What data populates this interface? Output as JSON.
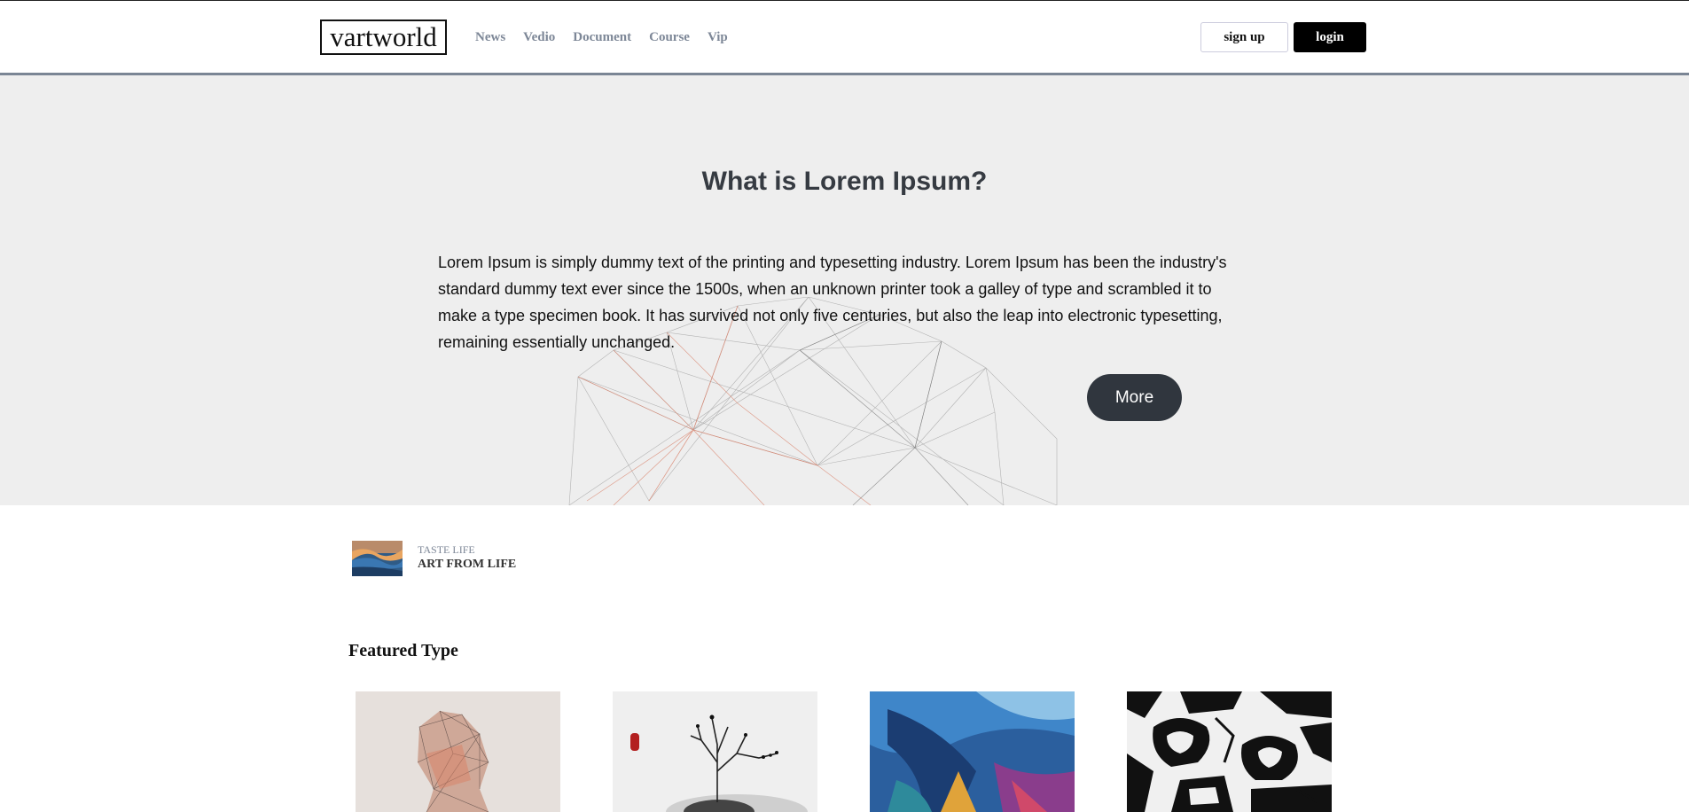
{
  "header": {
    "logo": "vartworld",
    "nav": [
      "News",
      "Vedio",
      "Document",
      "Course",
      "Vip"
    ],
    "signup_label": "sign up",
    "login_label": "login"
  },
  "hero": {
    "title": "What is Lorem Ipsum?",
    "body": "Lorem Ipsum is simply dummy text of the printing and typesetting industry. Lorem Ipsum has been the industry's standard dummy text ever since the 1500s, when an unknown printer took a galley of type and scrambled it to make a type specimen book. It has survived not only five centuries, but also the leap into electronic typesetting, remaining essentially unchanged.",
    "more_label": "More"
  },
  "taste": {
    "kicker": "TASTE LIFE",
    "tagline": "ART FROM LIFE"
  },
  "featured": {
    "title": "Featured Type"
  },
  "colors": {
    "accent_dark": "#30363e",
    "nav_grey": "#7d8797",
    "hero_bg": "#eeeeee"
  }
}
